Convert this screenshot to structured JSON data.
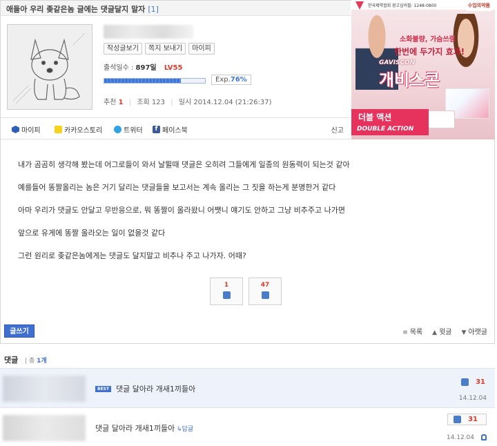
{
  "post": {
    "title": "애들아 우리 좆같은놈 글에는 댓글달지 말자",
    "comment_count_label": "[1]",
    "author_buttons": [
      "작성글보기",
      "쪽지 보내기",
      "마이피"
    ],
    "attendance_label": "출석일수 :",
    "attendance_value": "897일",
    "level": "LV55",
    "exp_label": "Exp.",
    "exp_value": "76%",
    "exp_fraction": 0.76,
    "recommend_label": "추천",
    "recommend_value": "1",
    "views_label": "조회",
    "views_value": "123",
    "date_label": "일시",
    "date_value": "2014.12.04 (21:26:37)",
    "body": [
      "내가 곰곰히 생각해 봤는데 어그로들이 와서 날뛸때 댓글은 오히려 그들에게 일종의 원동력이 되는것 같아",
      "예를들어 똥짤올리는 놈은 거기 달리는 댓글들을 보고서는 계속 올리는 그 짓을 하는게 분명한거 같다",
      "아마 우리가 댓글도 안달고 무반응으로, 뭐 똥짤이 올라왔니 어쨋니 얘기도 안하고 그냥 비추주고 나가면",
      "앞으로 유게에 똥짤 올라오는 일이 없을것 같다",
      "그런 원리로 좆같은놈에게는 댓글도 달지말고 비추나 주고 나가자. 어때?"
    ],
    "vote_up": "1",
    "vote_down": "47"
  },
  "share": {
    "items": [
      {
        "label": "마이피",
        "icon": "mypi-icon"
      },
      {
        "label": "카카오스토리",
        "icon": "kakaostory-icon"
      },
      {
        "label": "트위터",
        "icon": "twitter-icon"
      },
      {
        "label": "페이스북",
        "icon": "facebook-icon"
      }
    ],
    "report_label": "신고"
  },
  "ad": {
    "top_text": "한국제약협회 광고심의필: 1248-0800",
    "badge": "수입의약품",
    "line1": "소화불량, 가슴쓰림",
    "line2": "한번에 두가지 효과!",
    "brand_en": "GAVISCON",
    "brand": "개비스콘",
    "strip": "더블 액션",
    "strip_en": "DOUBLE ACTION"
  },
  "toolbar": {
    "write_label": "글쓰기",
    "list_label": "목록",
    "prev_label": "윗글",
    "next_label": "아랫글"
  },
  "comments": {
    "header": "댓글",
    "total_prefix": "총",
    "total_value": "1개",
    "best_label": "BEST",
    "reply_label": "답글",
    "items": [
      {
        "text": "댓글 달아라 개새1끼들아",
        "likes": "31",
        "date": "14.12.04"
      },
      {
        "text": "댓글 달아라 개새1끼들아",
        "likes": "31",
        "date": "14.12.04"
      }
    ]
  },
  "colors": {
    "accent": "#3f6fd1",
    "highlight_red": "#e0392b",
    "best_row_bg": "#eef2fb"
  }
}
